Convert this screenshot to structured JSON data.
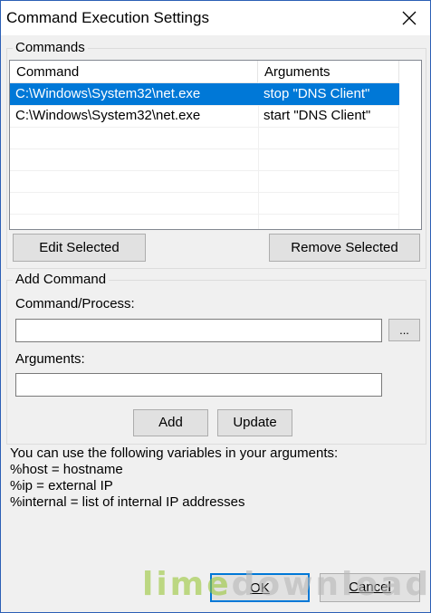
{
  "window": {
    "title": "Command Execution Settings",
    "close_icon": "close-icon"
  },
  "commands": {
    "group_label": "Commands",
    "columns": [
      "Command",
      "Arguments"
    ],
    "rows": [
      {
        "command": "C:\\Windows\\System32\\net.exe",
        "arguments": "stop \"DNS Client\"",
        "selected": true
      },
      {
        "command": "C:\\Windows\\System32\\net.exe",
        "arguments": "start \"DNS Client\"",
        "selected": false
      }
    ],
    "edit_label": "Edit Selected",
    "remove_label": "Remove Selected"
  },
  "add_command": {
    "group_label": "Add Command",
    "process_label": "Command/Process:",
    "process_value": "",
    "browse_label": "...",
    "arguments_label": "Arguments:",
    "arguments_value": "",
    "add_label": "Add",
    "update_label": "Update"
  },
  "help": {
    "intro": "You can use the following variables in your arguments:",
    "variables": [
      "%host = hostname",
      "%ip = external IP",
      "%internal = list of internal IP addresses"
    ]
  },
  "footer": {
    "ok_label": "OK",
    "cancel_label": "Cancel"
  },
  "watermark": {
    "part1": "lime",
    "part2": "download.com"
  },
  "colors": {
    "selection": "#0078d7",
    "border": "#2b5fb5",
    "watermark_green": "#9bc83a"
  }
}
